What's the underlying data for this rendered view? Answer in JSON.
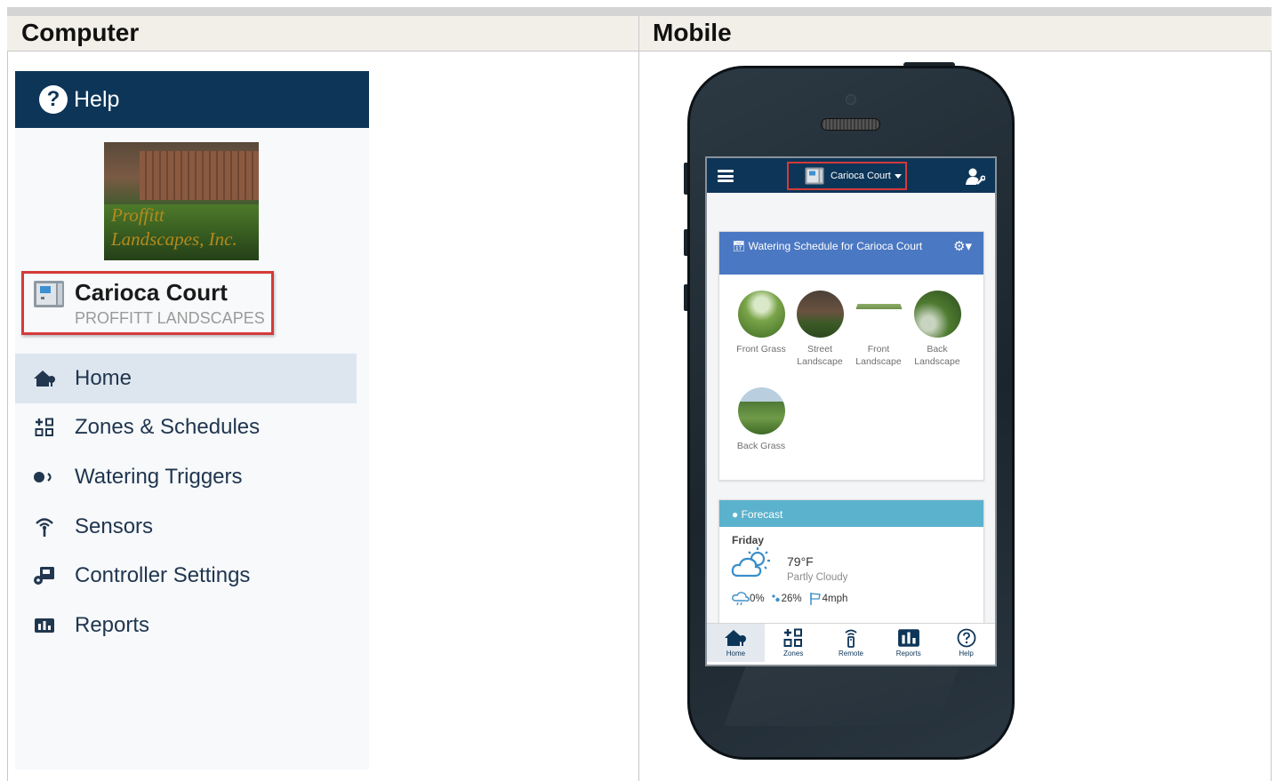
{
  "columns": {
    "computer": "Computer",
    "mobile": "Mobile"
  },
  "desktop": {
    "help_label": "Help",
    "logo_text": [
      "Proffitt",
      "Landscapes, Inc."
    ],
    "controller_name": "Carioca Court",
    "controller_owner": "PROFFITT LANDSCAPES",
    "nav": [
      {
        "label": "Home",
        "icon": "home-icon",
        "active": true
      },
      {
        "label": "Zones & Schedules",
        "icon": "zones-icon",
        "active": false
      },
      {
        "label": "Watering Triggers",
        "icon": "triggers-icon",
        "active": false
      },
      {
        "label": "Sensors",
        "icon": "sensor-icon",
        "active": false
      },
      {
        "label": "Controller Settings",
        "icon": "controller-settings-icon",
        "active": false
      },
      {
        "label": "Reports",
        "icon": "reports-icon",
        "active": false
      }
    ]
  },
  "mobile": {
    "controller_name": "Carioca Court",
    "schedule_title": "Watering Schedule for Carioca Court",
    "zones": [
      {
        "name": "Front Grass"
      },
      {
        "name": "Street Landscape"
      },
      {
        "name": "Front Landscape"
      },
      {
        "name": "Back Landscape"
      },
      {
        "name": "Back Grass"
      }
    ],
    "forecast_title": "Forecast",
    "forecast": {
      "day": "Friday",
      "temp": "79°F",
      "condition": "Partly Cloudy",
      "precip": "0%",
      "humidity": "26%",
      "wind": "4mph"
    },
    "bottom_nav": [
      {
        "label": "Home",
        "icon": "home-icon",
        "active": true
      },
      {
        "label": "Zones",
        "icon": "zones-icon",
        "active": false
      },
      {
        "label": "Remote",
        "icon": "remote-icon",
        "active": false
      },
      {
        "label": "Reports",
        "icon": "reports-icon",
        "active": false
      },
      {
        "label": "Help",
        "icon": "help-icon",
        "active": false
      }
    ]
  },
  "colors": {
    "navy": "#0d3558",
    "highlight_red": "#d43a3a",
    "schedule_blue": "#4b78c2",
    "forecast_teal": "#5bb2cc",
    "nav_active": "#dde6ee"
  }
}
